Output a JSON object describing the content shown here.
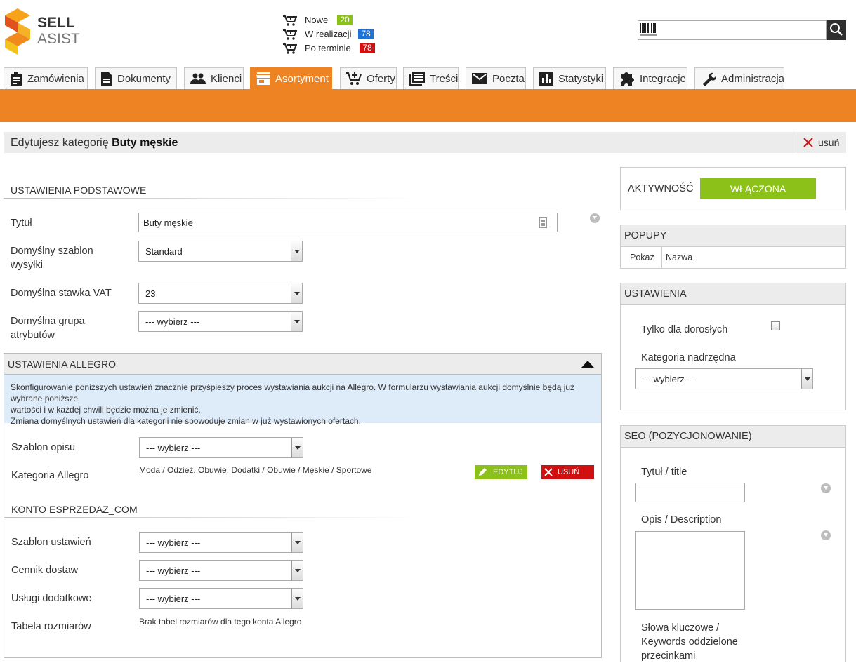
{
  "logo": {
    "line1": "SELL",
    "line2": "ASIST"
  },
  "order_status": [
    {
      "label": "Nowe",
      "count": "20",
      "color": "#8cc11a"
    },
    {
      "label": "W realizacji",
      "count": "78",
      "color": "#1e73d6"
    },
    {
      "label": "Po terminie",
      "count": "78",
      "color": "#d01010"
    }
  ],
  "search": {
    "value": ""
  },
  "nav_tabs": [
    {
      "label": "Zamówienia",
      "icon": "clipboard-icon"
    },
    {
      "label": "Dokumenty",
      "icon": "document-icon"
    },
    {
      "label": "Klienci",
      "icon": "people-icon"
    },
    {
      "label": "Asortyment",
      "icon": "store-icon",
      "active": true
    },
    {
      "label": "Oferty",
      "icon": "cart-add-icon"
    },
    {
      "label": "Treści",
      "icon": "list-icon"
    },
    {
      "label": "Poczta",
      "icon": "mail-icon"
    },
    {
      "label": "Statystyki",
      "icon": "chart-icon"
    },
    {
      "label": "Integracje",
      "icon": "puzzle-icon"
    },
    {
      "label": "Administracja",
      "icon": "wrench-icon"
    }
  ],
  "edit_bar": {
    "prefix": "Edytujesz kategorię",
    "category": "Buty męskie",
    "delete_label": "usuń"
  },
  "basic": {
    "title": "USTAWIENIA PODSTAWOWE",
    "title_label": "Tytuł",
    "title_value": "Buty męskie",
    "shipping_label": "Domyślny szablon wysyłki",
    "shipping_value": "Standard",
    "vat_label": "Domyślna stawka VAT",
    "vat_value": "23",
    "attr_label": "Domyślna grupa atrybutów",
    "attr_value": "--- wybierz ---"
  },
  "allegro": {
    "title": "USTAWIENIA ALLEGRO",
    "info_line1": "Skonfigurowanie poniższych ustawień znacznie przyśpieszy proces wystawiania aukcji na Allegro. W formularzu wystawiania aukcji domyślnie będą już wybrane poniższe",
    "info_line2": "wartości i w każdej chwili będzie można je zmienić.",
    "info_line3": "Zmiana domyślnych ustawień dla kategorii nie spowoduje zmian w już wystawionych ofertach.",
    "desc_template_label": "Szablon opisu",
    "desc_template_value": "--- wybierz ---",
    "category_label": "Kategoria Allegro",
    "category_value": "Moda / Odzież, Obuwie, Dodatki / Obuwie / Męskie / Sportowe",
    "edit_label": "EDYTUJ",
    "delete_label": "USUŃ"
  },
  "account": {
    "title": "KONTO ESPRZEDAZ_COM",
    "settings_label": "Szablon ustawień",
    "settings_value": "--- wybierz ---",
    "pricelist_label": "Cennik dostaw",
    "pricelist_value": "--- wybierz ---",
    "services_label": "Usługi dodatkowe",
    "services_value": "--- wybierz ---",
    "size_label": "Tabela rozmiarów",
    "size_value": "Brak tabel rozmiarów dla tego konta Allegro"
  },
  "activity": {
    "label": "AKTYWNOŚĆ",
    "value": "WŁĄCZONA"
  },
  "popups": {
    "title": "POPUPY",
    "col_show": "Pokaż",
    "col_name": "Nazwa"
  },
  "settings": {
    "title": "USTAWIENIA",
    "adults_label": "Tylko dla dorosłych",
    "parent_label": "Kategoria nadrzędna",
    "parent_value": "--- wybierz ---"
  },
  "seo": {
    "title": "SEO (POZYCJONOWANIE)",
    "title_label": "Tytuł / title",
    "title_value": "",
    "desc_label": "Opis / Description",
    "desc_value": "",
    "keywords_label_1": "Słowa kluczowe /",
    "keywords_label_2": "Keywords oddzielone",
    "keywords_label_3": "przecinkami"
  },
  "colors": {
    "accent": "#ee8323",
    "active_green": "#8cc11a",
    "danger_red": "#d01010"
  }
}
